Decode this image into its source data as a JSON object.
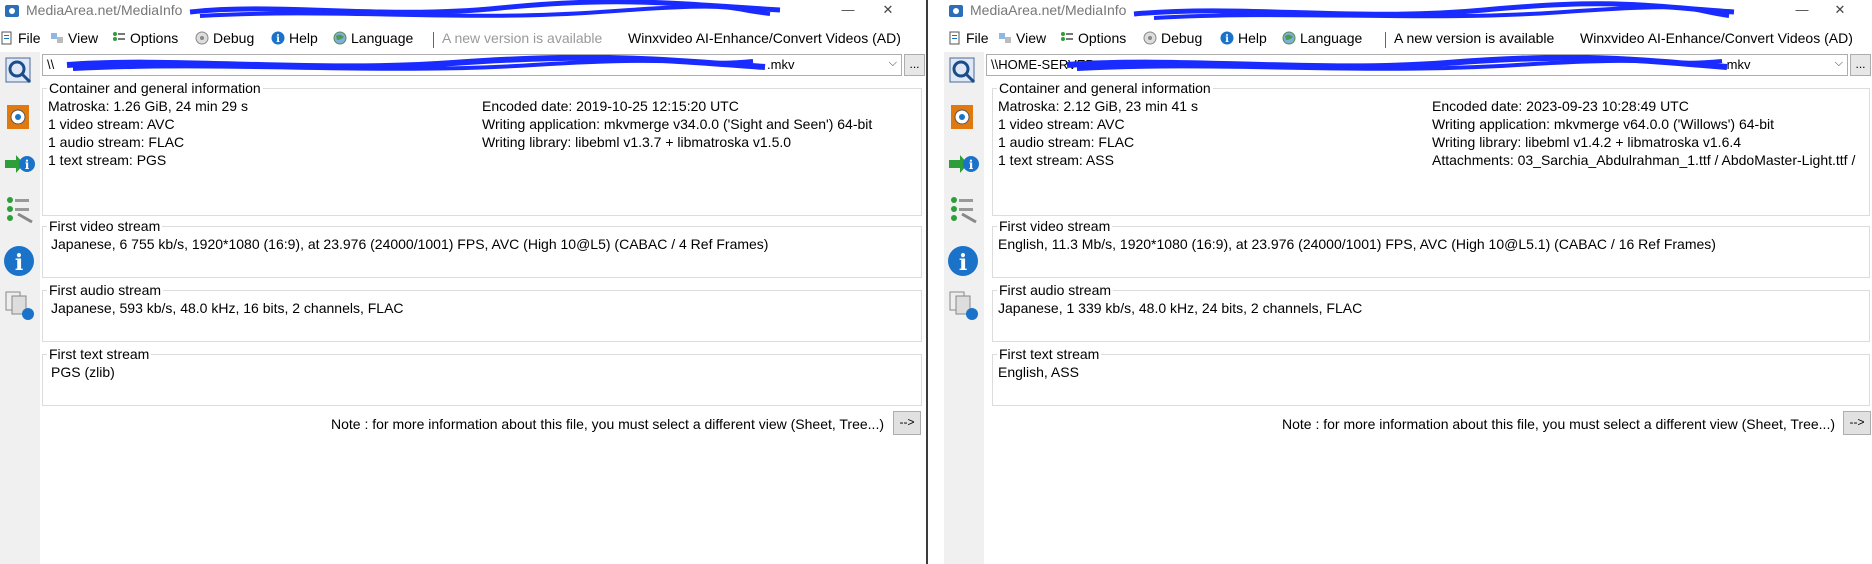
{
  "left": {
    "title": "MediaArea.net/MediaInfo",
    "menu": {
      "file": "File",
      "view": "View",
      "options": "Options",
      "debug": "Debug",
      "help": "Help",
      "language": "Language",
      "new_version": "A new version is available",
      "ad": "Winxvideo AI-Enhance/Convert Videos (AD)"
    },
    "file_path": "\\\\",
    "file_path_end": ".mkv",
    "general": {
      "title": "Container and general information",
      "l1": "Matroska: 1.26 GiB, 24 min 29 s",
      "l2": "1 video stream: AVC",
      "l3": "1 audio stream: FLAC",
      "l4": "1 text stream: PGS",
      "r1": "Encoded date: 2019-10-25 12:15:20 UTC",
      "r2": "Writing application: mkvmerge v34.0.0 ('Sight and Seen') 64-bit",
      "r3": "Writing library: libebml v1.3.7 + libmatroska v1.5.0"
    },
    "video": {
      "title": "First video stream",
      "text": "Japanese, 6 755 kb/s, 1920*1080 (16:9), at 23.976 (24000/1001) FPS, AVC (High 10@L5) (CABAC / 4 Ref Frames)"
    },
    "audio": {
      "title": "First audio stream",
      "text": "Japanese, 593 kb/s, 48.0 kHz, 16 bits, 2 channels, FLAC"
    },
    "textstream": {
      "title": "First text stream",
      "text": "PGS (zlib)"
    },
    "note": "Note : for more information about this file, you must select a different view (Sheet, Tree...)",
    "note_button": "-->"
  },
  "right": {
    "title": "MediaArea.net/MediaInfo",
    "menu": {
      "file": "File",
      "view": "View",
      "options": "Options",
      "debug": "Debug",
      "help": "Help",
      "language": "Language",
      "new_version": "A new version is available",
      "ad": "Winxvideo AI-Enhance/Convert Videos (AD)"
    },
    "file_path": "\\\\HOME-SERVER",
    "file_path_end": ".mkv",
    "general": {
      "title": "Container and general information",
      "l1": "Matroska: 2.12 GiB, 23 min 41 s",
      "l2": "1 video stream: AVC",
      "l3": "1 audio stream: FLAC",
      "l4": "1 text stream: ASS",
      "r1": "Encoded date: 2023-09-23 10:28:49 UTC",
      "r2": "Writing application: mkvmerge v64.0.0 ('Willows') 64-bit",
      "r3": "Writing library: libebml v1.4.2 + libmatroska v1.6.4",
      "r4": "Attachments: 03_Sarchia_Abdulrahman_1.ttf / AbdoMaster-Light.ttf /"
    },
    "video": {
      "title": "First video stream",
      "text": "English, 11.3 Mb/s, 1920*1080 (16:9), at 23.976 (24000/1001) FPS, AVC (High 10@L5.1) (CABAC / 16 Ref Frames)"
    },
    "audio": {
      "title": "First audio stream",
      "text": "Japanese, 1 339 kb/s, 48.0 kHz, 24 bits, 2 channels, FLAC"
    },
    "textstream": {
      "title": "First text stream",
      "text": "English, ASS"
    },
    "note": "Note : for more information about this file, you must select a different view (Sheet, Tree...)",
    "note_button": "-->"
  },
  "colors": {
    "redaction": "#1a2bff",
    "icon_blue": "#1a73c9",
    "icon_green": "#2e9e3a",
    "icon_orange": "#e07a10"
  }
}
